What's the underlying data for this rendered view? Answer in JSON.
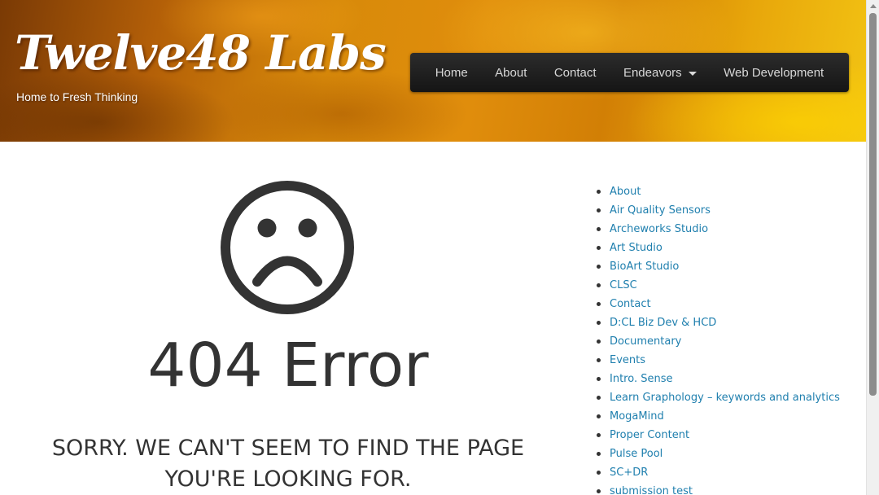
{
  "header": {
    "site_title": "Twelve48 Labs",
    "tagline": "Home to Fresh Thinking"
  },
  "nav": {
    "items": [
      {
        "label": "Home"
      },
      {
        "label": "About"
      },
      {
        "label": "Contact"
      },
      {
        "label": "Endeavors",
        "has_dropdown": true
      },
      {
        "label": "Web Development"
      }
    ]
  },
  "main": {
    "icon": "sad-face-icon",
    "error_title": "404 Error",
    "error_message": "Sorry. We can't seem to find the page you're looking for."
  },
  "sidebar": {
    "items": [
      {
        "label": "About"
      },
      {
        "label": "Air Quality Sensors"
      },
      {
        "label": "Archeworks Studio"
      },
      {
        "label": "Art Studio"
      },
      {
        "label": "BioArt Studio"
      },
      {
        "label": "CLSC"
      },
      {
        "label": "Contact"
      },
      {
        "label": "D:CL Biz Dev & HCD"
      },
      {
        "label": "Documentary"
      },
      {
        "label": "Events"
      },
      {
        "label": "Intro. Sense"
      },
      {
        "label": "Learn Graphology – keywords and analytics"
      },
      {
        "label": "MogaMind"
      },
      {
        "label": "Proper Content"
      },
      {
        "label": "Pulse Pool"
      },
      {
        "label": "SC+DR"
      },
      {
        "label": "submission test"
      }
    ]
  },
  "colors": {
    "link": "#1f7fae",
    "text": "#333333",
    "nav_bg": "#1e1e1e",
    "nav_text": "#d8d8d8",
    "header_accent": "#e08d0c"
  }
}
